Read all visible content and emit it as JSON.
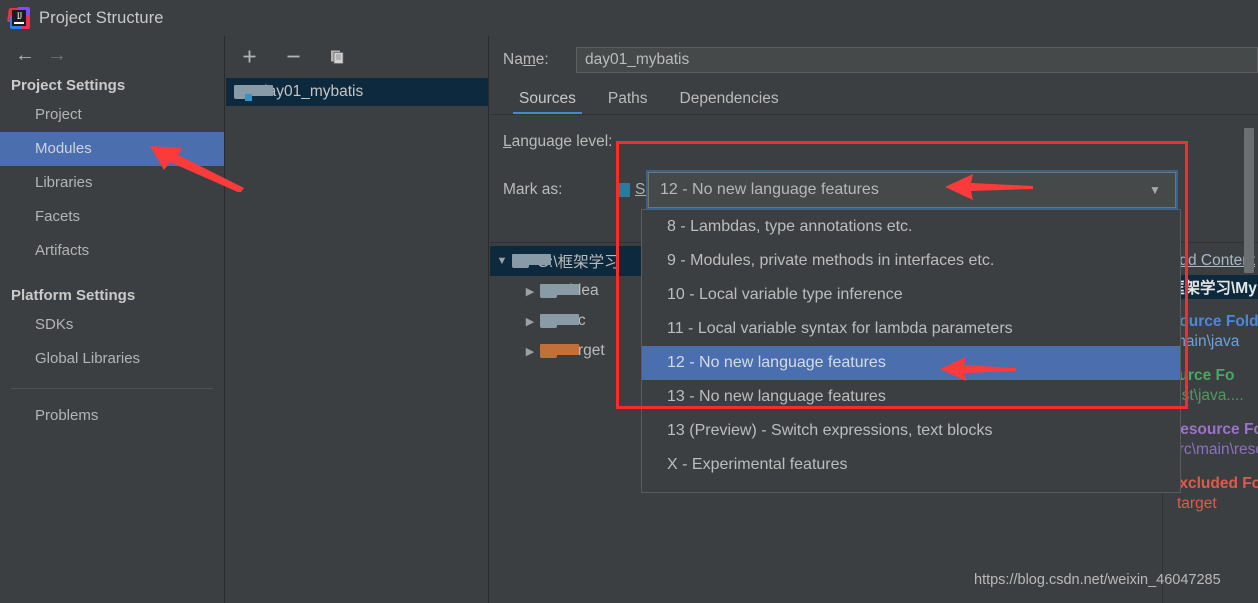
{
  "window": {
    "title": "Project Structure",
    "logo_icon": "intellij-idea-logo-icon"
  },
  "sidebar": {
    "back_icon": "arrow-left-icon",
    "forward_icon": "arrow-right-icon",
    "groups": [
      {
        "header": "Project Settings",
        "items": [
          {
            "label": "Project",
            "selected": false
          },
          {
            "label": "Modules",
            "selected": true
          },
          {
            "label": "Libraries",
            "selected": false
          },
          {
            "label": "Facets",
            "selected": false
          },
          {
            "label": "Artifacts",
            "selected": false
          }
        ]
      },
      {
        "header": "Platform Settings",
        "items": [
          {
            "label": "SDKs",
            "selected": false
          },
          {
            "label": "Global Libraries",
            "selected": false
          }
        ]
      }
    ],
    "problems_label": "Problems"
  },
  "module_panel": {
    "toolbar": {
      "add_icon": "plus-icon",
      "remove_icon": "minus-icon",
      "copy_icon": "copy-icon"
    },
    "modules": [
      {
        "name": "day01_mybatis",
        "selected": true,
        "icon": "module-folder-icon"
      }
    ]
  },
  "main": {
    "name_label": "Name:",
    "name_value": "day01_mybatis",
    "tabs": [
      {
        "label": "Sources",
        "active": true
      },
      {
        "label": "Paths",
        "active": false
      },
      {
        "label": "Dependencies",
        "active": false
      }
    ],
    "language_level_label": "Language level:",
    "language_level_value": "12 - No new language features",
    "combo_arrow_icon": "chevron-down-icon",
    "mark_as_label": "Mark as:",
    "mark_as_option": "Sources",
    "tree": [
      {
        "label": "G:\\框架学习",
        "depth": 0,
        "expanded": true,
        "selected": true,
        "icon": "folder-icon"
      },
      {
        "label": ".idea",
        "depth": 1,
        "expanded": false,
        "selected": false,
        "icon": "folder-icon"
      },
      {
        "label": "src",
        "depth": 1,
        "expanded": false,
        "selected": false,
        "icon": "folder-icon"
      },
      {
        "label": "target",
        "depth": 1,
        "expanded": false,
        "selected": false,
        "icon": "folder-orange-icon"
      }
    ],
    "right_pane": {
      "content_header": "Add Content",
      "content_path": "框架学习\\My",
      "source_folders_title": "Source Folders",
      "source_folders_path": "main\\java",
      "test_folders_title": "ource Fo",
      "test_folders_path": "est\\java....",
      "resource_folders_title": "Resource Folders",
      "resource_folders_path": "src\\main\\resour",
      "excluded_folders_title": "Excluded Folders",
      "excluded_folders_path": "target"
    }
  },
  "dropdown": {
    "items": [
      {
        "label": "8 - Lambdas, type annotations etc.",
        "selected": false
      },
      {
        "label": "9 - Modules, private methods in interfaces etc.",
        "selected": false
      },
      {
        "label": "10 - Local variable type inference",
        "selected": false
      },
      {
        "label": "11 - Local variable syntax for lambda parameters",
        "selected": false
      },
      {
        "label": "12 - No new language features",
        "selected": true
      },
      {
        "label": "13 - No new language features",
        "selected": false
      },
      {
        "label": "13 (Preview) - Switch expressions, text blocks",
        "selected": false
      },
      {
        "label": "X - Experimental features",
        "selected": false
      }
    ],
    "scrollbar_icon": "vertical-scrollbar"
  },
  "annotations": {
    "highlight_box_color": "#fc2b2b",
    "arrow_icon": "red-arrow-icon",
    "arrows": [
      {
        "name": "arrow-to-modules"
      },
      {
        "name": "arrow-to-language-combo"
      },
      {
        "name": "arrow-to-selected-item"
      }
    ]
  },
  "watermark": {
    "text": "https://blog.csdn.net/weixin_46047285"
  },
  "colors": {
    "background": "#3c3f41",
    "selection_blue": "#4b6eaf",
    "tree_selection": "#0d293e",
    "accent_tab": "#4a88c7",
    "annotation_red": "#fc2b2b"
  }
}
